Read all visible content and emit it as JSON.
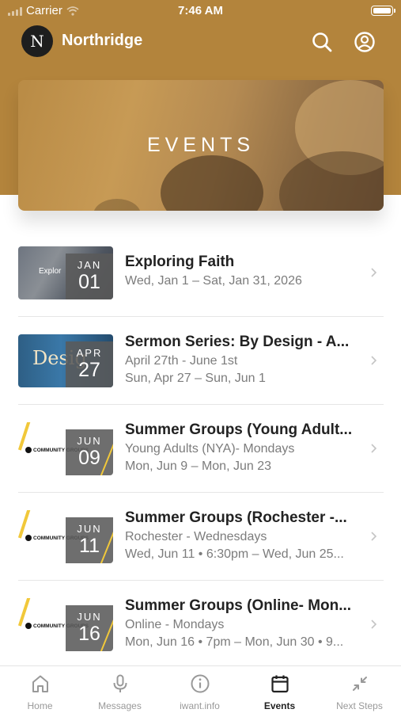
{
  "status_bar": {
    "carrier": "Carrier",
    "time": "7:46 AM"
  },
  "header": {
    "logo_letter": "N",
    "app_name": "Northridge"
  },
  "hero": {
    "title": "EVENTS"
  },
  "events": [
    {
      "title": "Exploring Faith",
      "lines": [
        "Wed, Jan 1 – Sat, Jan 31, 2026"
      ],
      "month": "JAN",
      "day": "01",
      "thumb_caption": "Explor"
    },
    {
      "title": "Sermon Series: By Design - A...",
      "lines": [
        "April 27th - June 1st",
        "Sun, Apr 27 – Sun, Jun 1"
      ],
      "month": "APR",
      "day": "27",
      "thumb_caption": "Desig"
    },
    {
      "title": "Summer Groups (Young Adult...",
      "lines": [
        "Young Adults (NYA)- Mondays",
        "Mon, Jun 9 – Mon, Jun 23"
      ],
      "month": "JUN",
      "day": "09",
      "thumb_caption": "COMMUNITY GROUPS"
    },
    {
      "title": "Summer Groups (Rochester -...",
      "lines": [
        "Rochester - Wednesdays",
        "Wed, Jun 11 • 6:30pm – Wed, Jun 25..."
      ],
      "month": "JUN",
      "day": "11",
      "thumb_caption": "COMMUNITY GROUPS"
    },
    {
      "title": "Summer Groups (Online- Mon...",
      "lines": [
        "Online - Mondays",
        "Mon, Jun 16 • 7pm – Mon, Jun 30 • 9..."
      ],
      "month": "JUN",
      "day": "16",
      "thumb_caption": "COMMUNITY GROUPS"
    }
  ],
  "tabs": [
    {
      "label": "Home",
      "icon": "home-icon"
    },
    {
      "label": "Messages",
      "icon": "microphone-icon"
    },
    {
      "label": "iwant.info",
      "icon": "info-icon"
    },
    {
      "label": "Events",
      "icon": "calendar-icon",
      "active": true
    },
    {
      "label": "Next Steps",
      "icon": "arrows-icon"
    }
  ],
  "colors": {
    "header_bg": "#b3843c",
    "accent_yellow": "#f1c83a"
  }
}
